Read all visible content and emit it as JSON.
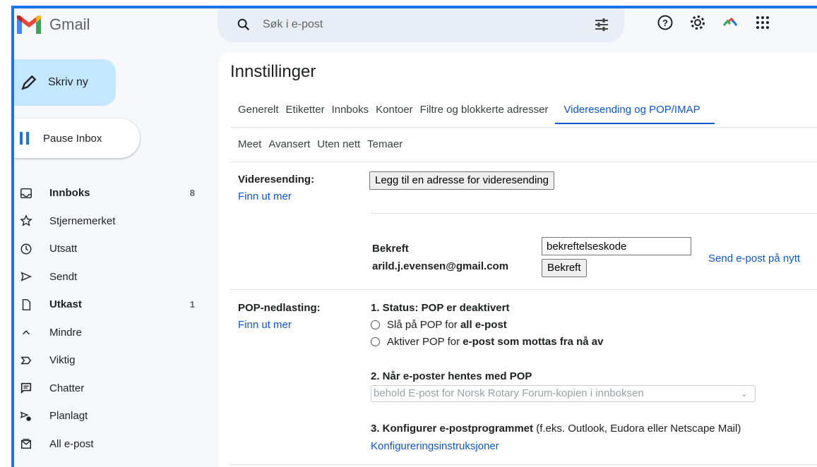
{
  "app": {
    "name": "Gmail"
  },
  "search": {
    "placeholder": "Søk i e-post"
  },
  "compose": {
    "label": "Skriv ny"
  },
  "pause": {
    "label": "Pause Inbox"
  },
  "nav": [
    {
      "label": "Innboks",
      "count": "8",
      "bold": true,
      "icon": "inbox-icon"
    },
    {
      "label": "Stjernemerket",
      "count": "",
      "bold": false,
      "icon": "star-icon"
    },
    {
      "label": "Utsatt",
      "count": "",
      "bold": false,
      "icon": "clock-icon"
    },
    {
      "label": "Sendt",
      "count": "",
      "bold": false,
      "icon": "send-icon"
    },
    {
      "label": "Utkast",
      "count": "1",
      "bold": true,
      "icon": "draft-icon"
    },
    {
      "label": "Mindre",
      "count": "",
      "bold": false,
      "icon": "chevron-up-icon"
    },
    {
      "label": "Viktig",
      "count": "",
      "bold": false,
      "icon": "important-icon"
    },
    {
      "label": "Chatter",
      "count": "",
      "bold": false,
      "icon": "chat-icon"
    },
    {
      "label": "Planlagt",
      "count": "",
      "bold": false,
      "icon": "scheduled-icon"
    },
    {
      "label": "All e-post",
      "count": "",
      "bold": false,
      "icon": "all-mail-icon"
    }
  ],
  "settings": {
    "title": "Innstillinger",
    "tabs_row1": [
      "Generelt",
      "Etiketter",
      "Innboks",
      "Kontoer",
      "Filtre og blokkerte adresser",
      "Videresending og POP/IMAP"
    ],
    "active_tab": "Videresending og POP/IMAP",
    "tabs_row2": [
      "Meet",
      "Avansert",
      "Uten nett",
      "Temaer"
    ],
    "forwarding": {
      "label": "Videresending:",
      "learn_more": "Finn ut mer",
      "add_button": "Legg til en adresse for videresending",
      "confirm_label": "Bekreft",
      "confirm_email": "arild.j.evensen@gmail.com",
      "code_value": "bekreftelseskode",
      "confirm_button": "Bekreft",
      "resend_link": "Send e-post på nytt"
    },
    "pop": {
      "label": "POP-nedlasting:",
      "learn_more": "Finn ut mer",
      "status_heading": "1. Status: POP er deaktivert",
      "option1_prefix": "Slå på POP for ",
      "option1_bold": "all e-post",
      "option2_prefix": "Aktiver POP for ",
      "option2_bold": "e-post som mottas fra nå av",
      "when_heading": "2. Når e-poster hentes med POP",
      "select_value": "behold E-post for Norsk Rotary Forum-kopien i innboksen",
      "configure_heading": "3. Konfigurer e-postprogrammet",
      "configure_note": " (f.eks. Outlook, Eudora eller Netscape Mail)",
      "configure_link": "Konfigureringsinstruksjoner"
    }
  },
  "colors": {
    "accent": "#1a73e8",
    "compose_bg": "#c2e7ff",
    "link": "#0b57d0"
  }
}
